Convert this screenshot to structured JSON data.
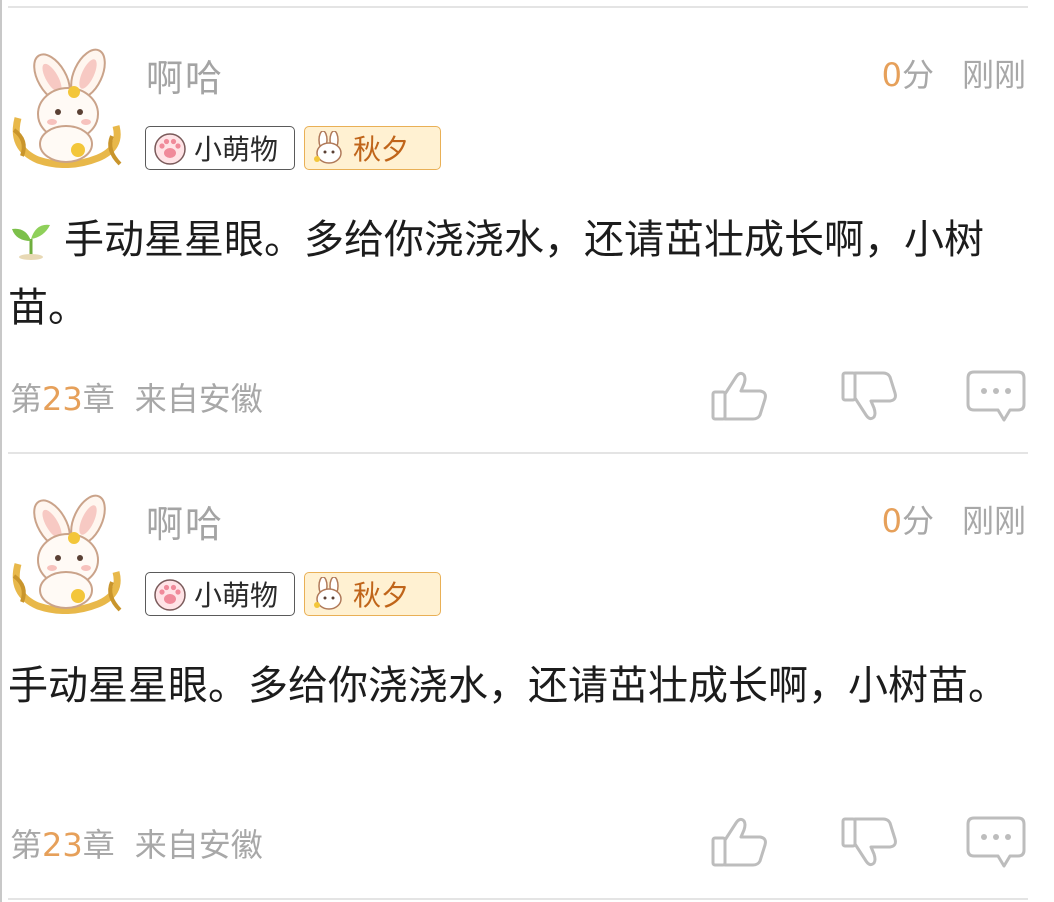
{
  "comments": [
    {
      "user": "啊哈",
      "score_num": "0",
      "score_unit": "分",
      "time": "刚刚",
      "badge1": "小萌物",
      "badge2": "秋夕",
      "text": "手动星星眼。多给你浇浇水，还请茁壮成长啊，小树苗。",
      "has_sprout": true,
      "chapter_prefix": "第",
      "chapter_num": "23",
      "chapter_suffix": "章",
      "location": "来自安徽"
    },
    {
      "user": "啊哈",
      "score_num": "0",
      "score_unit": "分",
      "time": "刚刚",
      "badge1": "小萌物",
      "badge2": "秋夕",
      "text": "手动星星眼。多给你浇浇水，还请茁壮成长啊，小树苗。",
      "has_sprout": false,
      "chapter_prefix": "第",
      "chapter_num": "23",
      "chapter_suffix": "章",
      "location": "来自安徽"
    }
  ],
  "icons": {
    "avatar": "bunny-avatar-icon",
    "badge1": "paw-icon",
    "badge2": "bunny-icon",
    "sprout": "sprout-icon",
    "like": "thumbs-up-icon",
    "dislike": "thumbs-down-icon",
    "reply": "comment-icon"
  },
  "colors": {
    "accent": "#e6a05a",
    "muted_text": "#a8a8a8",
    "fan_badge_bg": "#fff1d2",
    "fan_badge_border": "#e9b056"
  }
}
